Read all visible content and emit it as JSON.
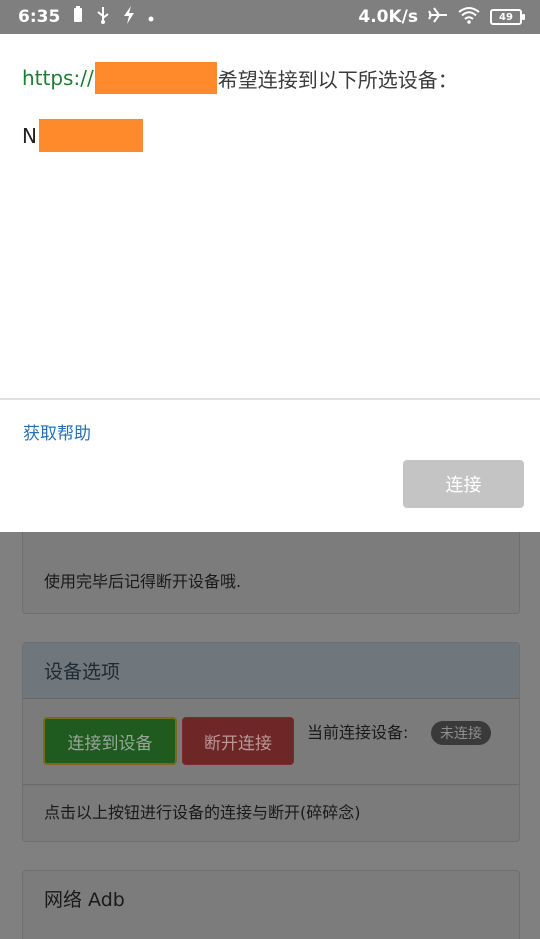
{
  "status_bar": {
    "time": "6:35",
    "left_icons": [
      "battery-saver-icon",
      "usb-icon",
      "flash-icon",
      "dot-icon"
    ],
    "net_speed": "4.0K/s",
    "right_icons": [
      "airplane-icon",
      "wifi-icon"
    ],
    "battery_level": "49"
  },
  "dialog": {
    "origin_scheme": "https://",
    "title_suffix": "希望连接到以下所选设备：",
    "device_prefix": "N",
    "help_link": "获取帮助",
    "connect_button": "连接"
  },
  "background_page": {
    "card1": {
      "text": "使用完毕后记得断开设备哦."
    },
    "device_options": {
      "title": "设备选项",
      "connect_button": "连接到设备",
      "disconnect_button": "断开连接",
      "current_label": "当前连接设备:",
      "status_badge": "未连接",
      "footer_text": "点击以上按钮进行设备的连接与断开(碎碎念)"
    },
    "network_adb": {
      "title": "网络 Adb"
    }
  }
}
